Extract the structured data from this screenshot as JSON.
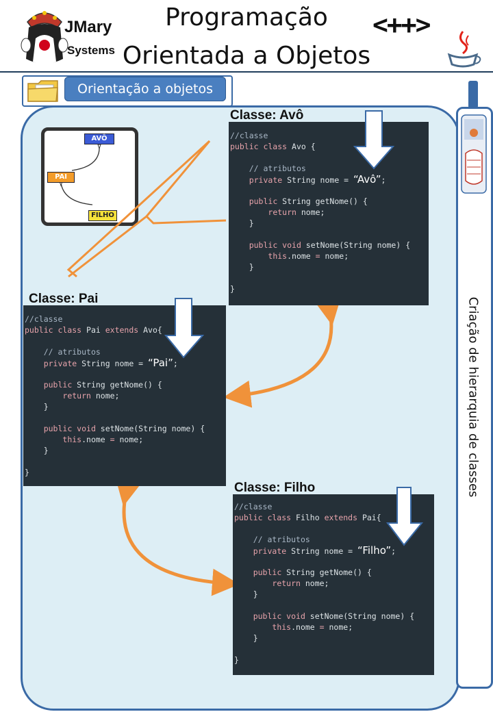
{
  "header": {
    "title_line1": "Programação",
    "title_line2": "Orientada a Objetos",
    "logo_name": "JMary",
    "logo_sub": "Systems",
    "cpp_text": "<++>"
  },
  "section": {
    "label": "Orientação a objetos"
  },
  "sidebar": {
    "text": "Criação de hierarquia de classes"
  },
  "diagram": {
    "node_avo": "AVÔ",
    "node_pai": "PAI",
    "node_filho": "FILHO"
  },
  "classes": [
    {
      "label": "Classe: Avô",
      "lines": [
        {
          "parts": [
            [
              "cm",
              "//classe"
            ]
          ]
        },
        {
          "parts": [
            [
              "kw",
              "public class"
            ],
            [
              "tx",
              " Avo {"
            ]
          ]
        },
        {
          "parts": []
        },
        {
          "parts": [
            [
              "tx",
              "    "
            ],
            [
              "cm",
              "// atributos"
            ]
          ]
        },
        {
          "parts": [
            [
              "tx",
              "    "
            ],
            [
              "kw",
              "private"
            ],
            [
              "tx",
              " String nome = "
            ],
            [
              "big",
              "“Avô”"
            ],
            [
              "tx",
              ";"
            ]
          ]
        },
        {
          "parts": []
        },
        {
          "parts": [
            [
              "tx",
              "    "
            ],
            [
              "kw",
              "public"
            ],
            [
              "tx",
              " String getNome() {"
            ]
          ]
        },
        {
          "parts": [
            [
              "tx",
              "        "
            ],
            [
              "kw",
              "return"
            ],
            [
              "tx",
              " nome;"
            ]
          ]
        },
        {
          "parts": [
            [
              "tx",
              "    }"
            ]
          ]
        },
        {
          "parts": []
        },
        {
          "parts": [
            [
              "tx",
              "    "
            ],
            [
              "kw",
              "public void"
            ],
            [
              "tx",
              " setNome(String nome) {"
            ]
          ]
        },
        {
          "parts": [
            [
              "tx",
              "        "
            ],
            [
              "kw",
              "this"
            ],
            [
              "tx",
              ".nome "
            ],
            [
              "kw",
              "="
            ],
            [
              "tx",
              " nome;"
            ]
          ]
        },
        {
          "parts": [
            [
              "tx",
              "    }"
            ]
          ]
        },
        {
          "parts": []
        },
        {
          "parts": [
            [
              "tx",
              "}"
            ]
          ]
        }
      ]
    },
    {
      "label": "Classe: Pai",
      "lines": [
        {
          "parts": [
            [
              "cm",
              "//classe"
            ]
          ]
        },
        {
          "parts": [
            [
              "kw",
              "public class"
            ],
            [
              "tx",
              " Pai "
            ],
            [
              "kw",
              "extends"
            ],
            [
              "tx",
              " Avo{"
            ]
          ]
        },
        {
          "parts": []
        },
        {
          "parts": [
            [
              "tx",
              "    "
            ],
            [
              "cm",
              "// atributos"
            ]
          ]
        },
        {
          "parts": [
            [
              "tx",
              "    "
            ],
            [
              "kw",
              "private"
            ],
            [
              "tx",
              " String nome = "
            ],
            [
              "big",
              "“Pai”"
            ],
            [
              "tx",
              ";"
            ]
          ]
        },
        {
          "parts": []
        },
        {
          "parts": [
            [
              "tx",
              "    "
            ],
            [
              "kw",
              "public"
            ],
            [
              "tx",
              " String getNome() {"
            ]
          ]
        },
        {
          "parts": [
            [
              "tx",
              "        "
            ],
            [
              "kw",
              "return"
            ],
            [
              "tx",
              " nome;"
            ]
          ]
        },
        {
          "parts": [
            [
              "tx",
              "    }"
            ]
          ]
        },
        {
          "parts": []
        },
        {
          "parts": [
            [
              "tx",
              "    "
            ],
            [
              "kw",
              "public void"
            ],
            [
              "tx",
              " setNome(String nome) {"
            ]
          ]
        },
        {
          "parts": [
            [
              "tx",
              "        "
            ],
            [
              "kw",
              "this"
            ],
            [
              "tx",
              ".nome "
            ],
            [
              "kw",
              "="
            ],
            [
              "tx",
              " nome;"
            ]
          ]
        },
        {
          "parts": [
            [
              "tx",
              "    }"
            ]
          ]
        },
        {
          "parts": []
        },
        {
          "parts": [
            [
              "tx",
              "}"
            ]
          ]
        }
      ]
    },
    {
      "label": "Classe: Filho",
      "lines": [
        {
          "parts": [
            [
              "cm",
              "//classe"
            ]
          ]
        },
        {
          "parts": [
            [
              "kw",
              "public class"
            ],
            [
              "tx",
              " Filho "
            ],
            [
              "kw",
              "extends"
            ],
            [
              "tx",
              " Pai{"
            ]
          ]
        },
        {
          "parts": []
        },
        {
          "parts": [
            [
              "tx",
              "    "
            ],
            [
              "cm",
              "// atributos"
            ]
          ]
        },
        {
          "parts": [
            [
              "tx",
              "    "
            ],
            [
              "kw",
              "private"
            ],
            [
              "tx",
              " String nome = "
            ],
            [
              "big",
              "“Filho”"
            ],
            [
              "tx",
              ";"
            ]
          ]
        },
        {
          "parts": []
        },
        {
          "parts": [
            [
              "tx",
              "    "
            ],
            [
              "kw",
              "public"
            ],
            [
              "tx",
              " String getNome() {"
            ]
          ]
        },
        {
          "parts": [
            [
              "tx",
              "        "
            ],
            [
              "kw",
              "return"
            ],
            [
              "tx",
              " nome;"
            ]
          ]
        },
        {
          "parts": [
            [
              "tx",
              "    }"
            ]
          ]
        },
        {
          "parts": []
        },
        {
          "parts": [
            [
              "tx",
              "    "
            ],
            [
              "kw",
              "public void"
            ],
            [
              "tx",
              " setNome(String nome) {"
            ]
          ]
        },
        {
          "parts": [
            [
              "tx",
              "        "
            ],
            [
              "kw",
              "this"
            ],
            [
              "tx",
              ".nome "
            ],
            [
              "kw",
              "="
            ],
            [
              "tx",
              " nome;"
            ]
          ]
        },
        {
          "parts": [
            [
              "tx",
              "    }"
            ]
          ]
        },
        {
          "parts": []
        },
        {
          "parts": [
            [
              "tx",
              "}"
            ]
          ]
        }
      ]
    }
  ],
  "colors": {
    "accent": "#3a6aa6",
    "panel_bg": "#ddeef5",
    "code_bg": "#253038",
    "arrow_orange": "#f0923a"
  }
}
